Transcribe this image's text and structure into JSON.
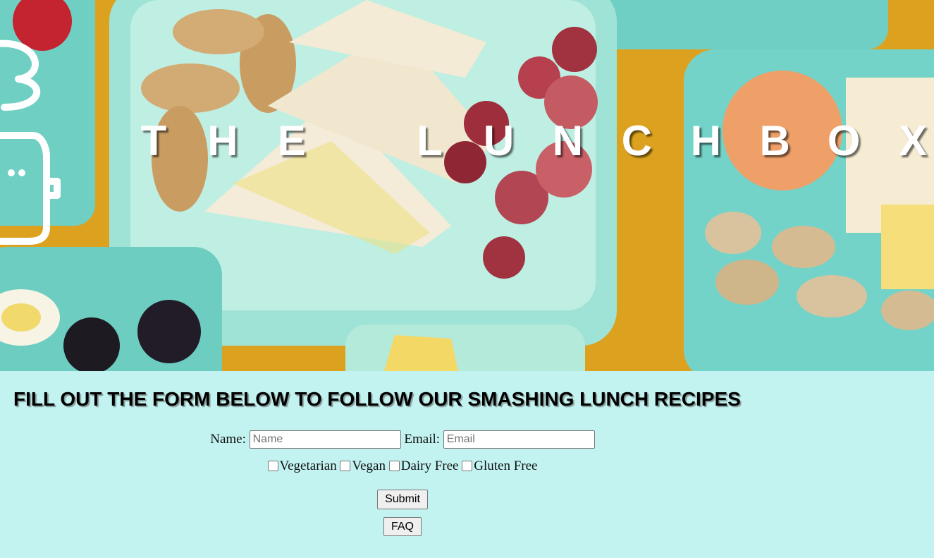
{
  "hero": {
    "title_letters": [
      "T",
      "H",
      "E",
      " ",
      "L",
      "U",
      "N",
      "C",
      "H",
      "B",
      "O",
      "X"
    ]
  },
  "form": {
    "heading": "FILL OUT THE FORM BELOW TO FOLLOW OUR SMASHING LUNCH RECIPES",
    "name_label": "Name:",
    "name_placeholder": "Name",
    "email_label": "Email:",
    "email_placeholder": "Email",
    "options": [
      "Vegetarian",
      "Vegan",
      "Dairy Free",
      "Gluten Free"
    ],
    "submit_label": "Submit",
    "faq_label": "FAQ"
  },
  "colors": {
    "page_background": "#c3f3f1",
    "hero_background": "#e0a320",
    "lunchbox_teal": "#7fd6cb"
  }
}
